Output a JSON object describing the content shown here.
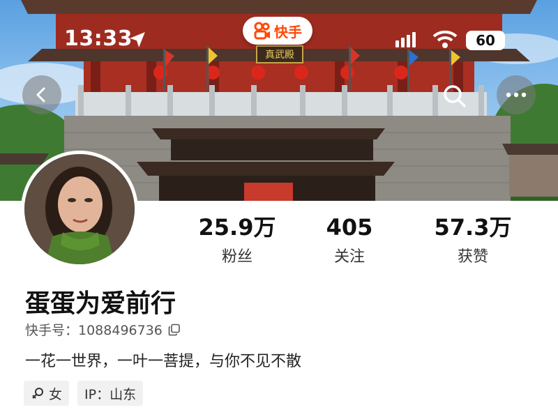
{
  "status_bar": {
    "time": "13:33",
    "battery": "60",
    "icons": [
      "location-arrow-icon",
      "signal-icon",
      "wifi-icon",
      "battery-icon"
    ]
  },
  "app_badge": {
    "label": "快手",
    "icon": "kuaishou-logo-icon",
    "color": "#ff4906"
  },
  "header": {
    "buttons": [
      "back-icon",
      "search-icon",
      "more-icon"
    ],
    "background_image": "temple-gate-photo",
    "plaque_text": "真武殿"
  },
  "profile": {
    "avatar": "avatar-photo",
    "stats": [
      {
        "value": "25.9万",
        "label": "粉丝"
      },
      {
        "value": "405",
        "label": "关注"
      },
      {
        "value": "57.3万",
        "label": "获赞"
      }
    ],
    "nickname": "蛋蛋为爱前行",
    "kwai_id": "快手号：1088496736",
    "bio": "一花一世界，一叶一菩提，与你不见不散",
    "tags": [
      {
        "icon": "female-icon",
        "label": "女"
      },
      {
        "label": "IP：山东"
      }
    ]
  }
}
